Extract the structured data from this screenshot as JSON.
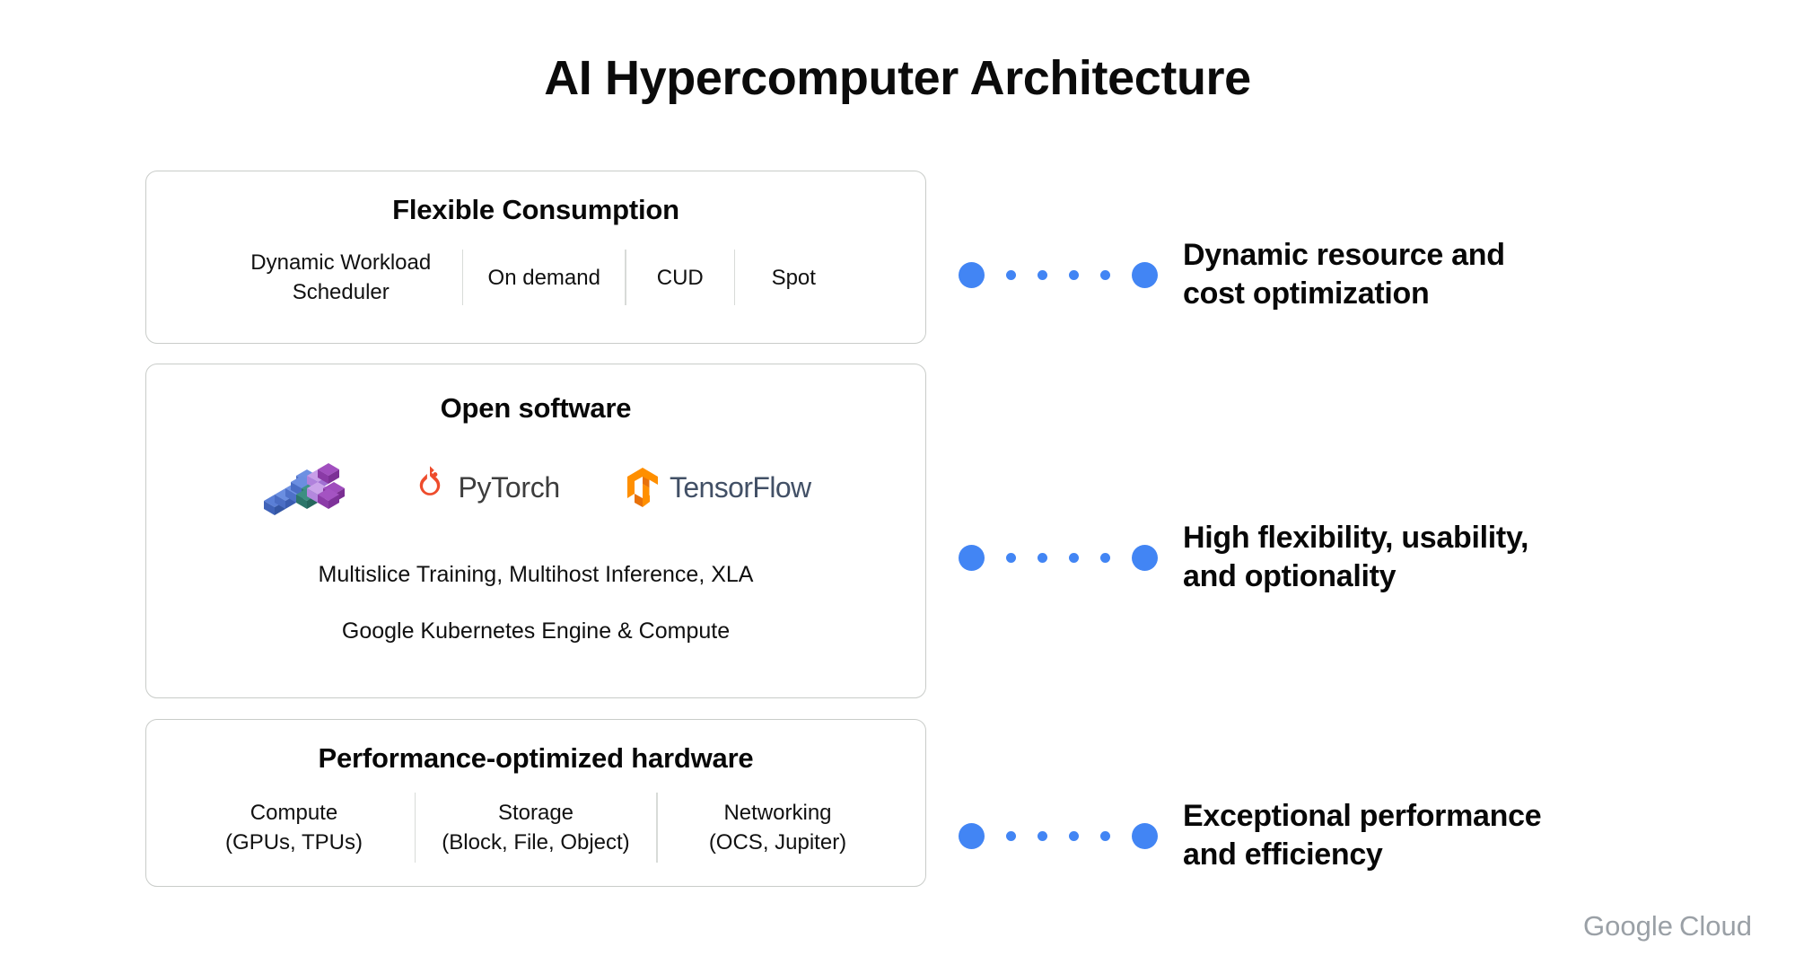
{
  "title": "AI Hypercomputer Architecture",
  "cards": [
    {
      "id": "flexible-consumption",
      "title": "Flexible Consumption",
      "items": [
        "Dynamic Workload\nScheduler",
        "On demand",
        "CUD",
        "Spot"
      ]
    },
    {
      "id": "open-software",
      "title": "Open software",
      "logos": [
        {
          "name": "jax-logo",
          "label": "JAX"
        },
        {
          "name": "pytorch-logo",
          "label": "PyTorch"
        },
        {
          "name": "tensorflow-logo",
          "label": "TensorFlow"
        }
      ],
      "lines": [
        "Multislice Training, Multihost Inference, XLA",
        "Google Kubernetes Engine & Compute"
      ]
    },
    {
      "id": "performance-optimized-hardware",
      "title": "Performance-optimized hardware",
      "items": [
        "Compute\n(GPUs, TPUs)",
        "Storage\n(Block, File, Object)",
        "Networking\n(OCS, Jupiter)"
      ]
    }
  ],
  "benefits": [
    {
      "id": "benefit-dynamic-resource",
      "text": "Dynamic resource and\ncost optimization"
    },
    {
      "id": "benefit-high-flexibility",
      "text": "High flexibility, usability,\nand optionality"
    },
    {
      "id": "benefit-exceptional-performance",
      "text": "Exceptional performance\nand efficiency"
    }
  ],
  "watermark": {
    "brand": "Google",
    "product": "Cloud"
  },
  "colors": {
    "accent_blue": "#4285f4",
    "card_border": "#c9ccc9",
    "divider": "#d8dbd8",
    "pytorch_orange": "#ee4c2c",
    "tensorflow_orange": "#ff8f00",
    "tensorflow_text": "#425066",
    "watermark_gray": "#9aa0a6"
  }
}
